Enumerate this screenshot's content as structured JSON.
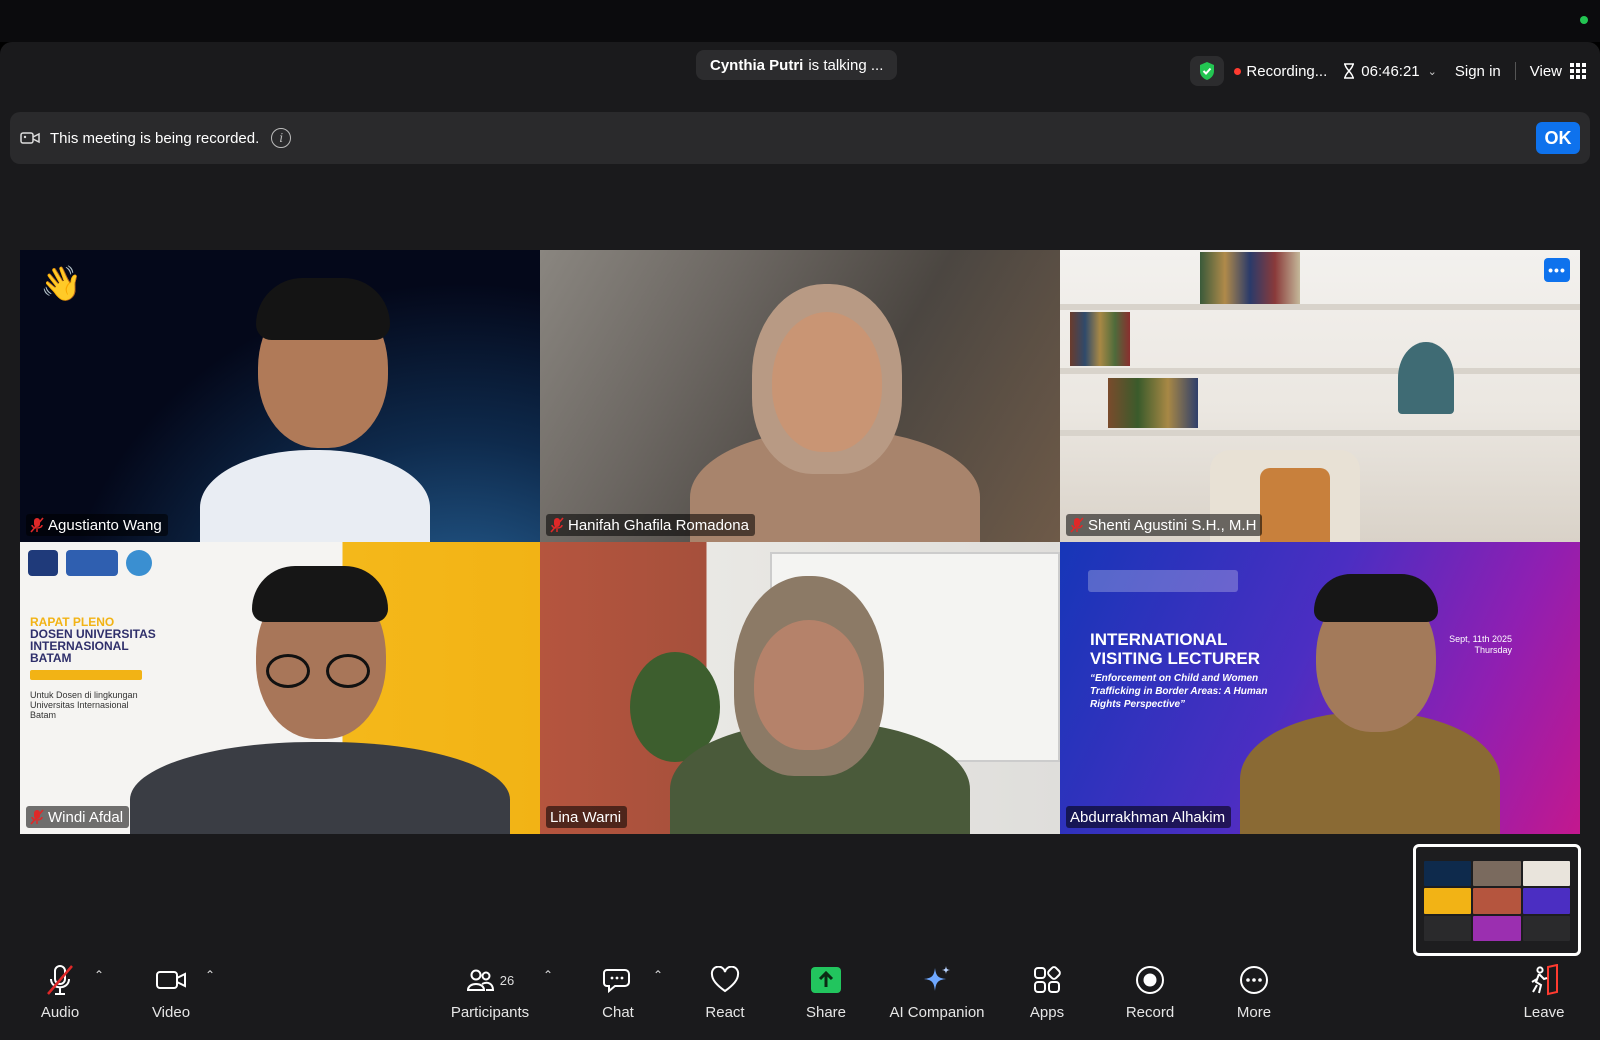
{
  "status_bar": {
    "talking_name": "Cynthia Putri",
    "talking_suffix": "is talking ..."
  },
  "meeting": {
    "recording_label": "Recording...",
    "timer": "06:46:21",
    "sign_in": "Sign in",
    "view": "View"
  },
  "banner": {
    "text": "This meeting is being recorded.",
    "ok": "OK"
  },
  "tiles": [
    {
      "name": "Agustianto Wang",
      "muted": true
    },
    {
      "name": "Hanifah Ghafila Romadona",
      "muted": true
    },
    {
      "name": "Shenti Agustini S.H., M.H",
      "muted": true
    },
    {
      "name": "Windi Afdal",
      "muted": true
    },
    {
      "name": "Lina Warni",
      "muted": false
    },
    {
      "name": "Abdurrakhman Alhakim",
      "muted": false
    }
  ],
  "slides": {
    "t4_line1": "RAPAT PLENO",
    "t4_line2": "DOSEN UNIVERSITAS",
    "t4_line3": "INTERNASIONAL",
    "t4_line4": "BATAM",
    "t4_sub": "Untuk Dosen di lingkungan Universitas Internasional Batam",
    "t6_title_1": "INTERNATIONAL",
    "t6_title_2": "VISITING LECTURER",
    "t6_sub": "“Enforcement on Child and Women Trafficking in Border Areas: A Human Rights Perspective”",
    "t6_date_1": "Sept, 11th 2025",
    "t6_date_2": "Thursday"
  },
  "toolbar": {
    "audio": "Audio",
    "video": "Video",
    "participants": "Participants",
    "participants_count": "26",
    "chat": "Chat",
    "react": "React",
    "share": "Share",
    "ai_companion": "AI Companion",
    "apps": "Apps",
    "record": "Record",
    "more": "More",
    "leave": "Leave"
  },
  "colors": {
    "accent": "#0e72ed",
    "share_green": "#22c55e",
    "record_red": "#ff3b30",
    "bg": "#1a1a1c"
  }
}
